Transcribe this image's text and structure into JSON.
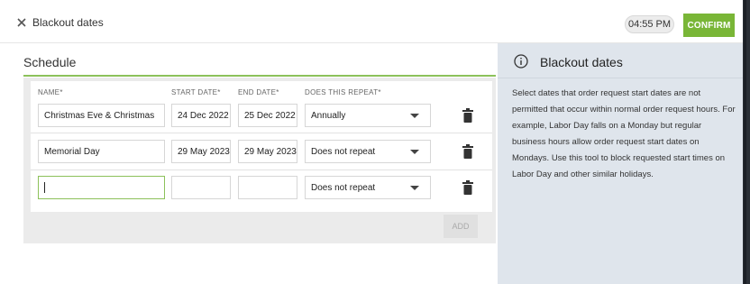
{
  "header": {
    "title": "Blackout dates",
    "time": "04:55 PM",
    "confirm_label": "CONFIRM"
  },
  "schedule": {
    "title": "Schedule",
    "columns": [
      "NAME*",
      "START DATE*",
      "END DATE*",
      "DOES THIS REPEAT*"
    ],
    "rows": [
      {
        "name": "Christmas Eve & Christmas",
        "start": "24 Dec 2022",
        "end": "25 Dec 2022",
        "repeat": "Annually"
      },
      {
        "name": "Memorial Day",
        "start": "29 May 2023",
        "end": "29 May 2023",
        "repeat": "Does not repeat"
      },
      {
        "name": "",
        "start": "",
        "end": "",
        "repeat": "Does not repeat"
      }
    ],
    "add_label": "ADD"
  },
  "info": {
    "title": "Blackout dates",
    "body": "Select dates that order request start dates are not permitted that occur within normal order request hours. For example, Labor Day falls on a Monday but regular business hours allow order request start dates on Mondays. Use this tool to block requested start times on Labor Day and other similar holidays."
  },
  "colors": {
    "accent": "#79b637",
    "info_bg": "#dfe5ec"
  }
}
